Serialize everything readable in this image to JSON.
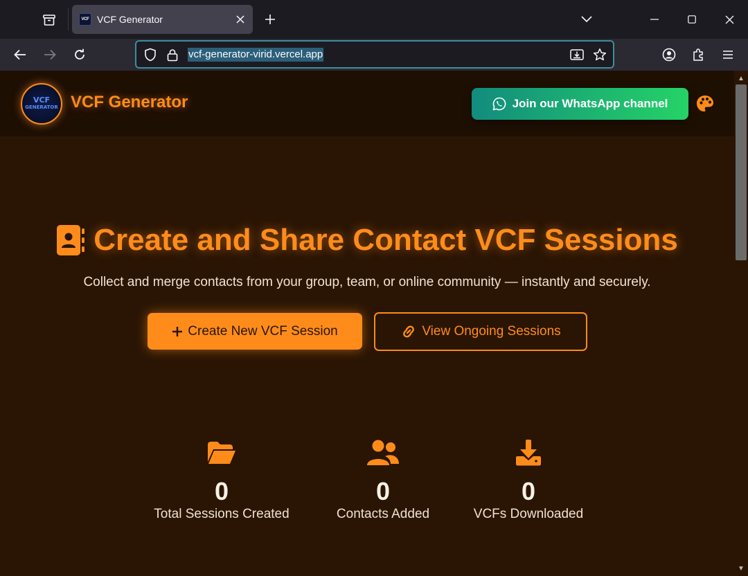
{
  "browser": {
    "tab_title": "VCF Generator",
    "favicon_text": "VCF",
    "url": "vcf-generator-virid.vercel.app"
  },
  "header": {
    "logo_text_line1": "VCF",
    "logo_text_line2": "GENERATOR",
    "brand": "VCF Generator",
    "whatsapp_label": "Join our WhatsApp channel"
  },
  "hero": {
    "title": "Create and Share Contact VCF Sessions",
    "subtitle": "Collect and merge contacts from your group, team, or online community — instantly and securely.",
    "primary_button": "Create New VCF Session",
    "secondary_button": "View Ongoing Sessions"
  },
  "stats": [
    {
      "icon": "folder-open-icon",
      "value": "0",
      "label": "Total Sessions Created"
    },
    {
      "icon": "users-icon",
      "value": "0",
      "label": "Contacts Added"
    },
    {
      "icon": "download-icon",
      "value": "0",
      "label": "VCFs Downloaded"
    }
  ],
  "colors": {
    "accent": "#ff8c1a",
    "page_bg": "#2a1504",
    "header_bg": "#1e0f03",
    "whatsapp_start": "#128c7e",
    "whatsapp_end": "#25d366"
  }
}
